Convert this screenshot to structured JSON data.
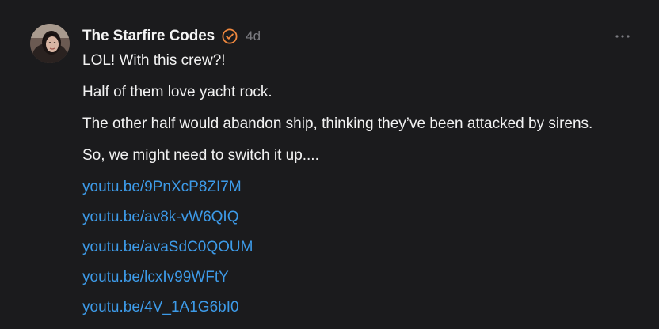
{
  "post": {
    "author": "The Starfire Codes",
    "verified_icon": "verified-badge-icon",
    "verified_color": "#f0883e",
    "timestamp": "4d",
    "more_icon": "more-options-icon",
    "paragraphs": [
      "LOL! With this crew?!",
      "Half of them love yacht rock.",
      "The other half would abandon ship, thinking they’ve been attacked by sirens.",
      "So, we might need to switch it up...."
    ],
    "links": [
      "youtu.be/9PnXcP8ZI7M",
      "youtu.be/av8k-vW6QIQ",
      "youtu.be/avaSdC0QOUM",
      "youtu.be/lcxIv99WFtY",
      "youtu.be/4V_1A1G6bI0"
    ],
    "link_color": "#3d9be9"
  }
}
